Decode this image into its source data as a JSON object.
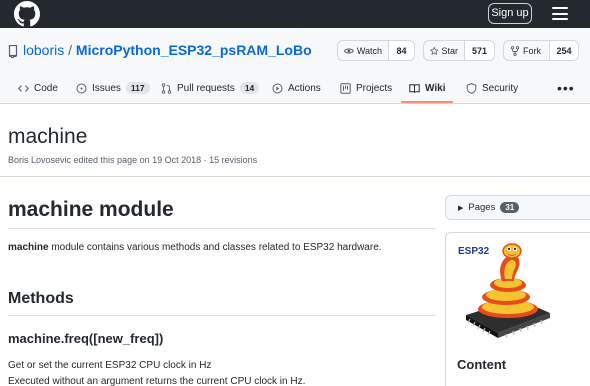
{
  "topbar": {
    "logo_icon": "github-mark-icon",
    "signup_label": "Sign up",
    "menu_icon": "hamburger-menu-icon"
  },
  "repo": {
    "icon": "repo-icon",
    "owner": "loboris",
    "separator": "/",
    "name": "MicroPython_ESP32_psRAM_LoBo",
    "watch": {
      "label": "Watch",
      "count": "84",
      "icon": "eye-icon"
    },
    "star": {
      "label": "Star",
      "count": "571",
      "icon": "star-icon"
    },
    "fork": {
      "label": "Fork",
      "count": "254",
      "icon": "fork-icon"
    }
  },
  "tabs": [
    {
      "label": "Code",
      "icon": "code-icon"
    },
    {
      "label": "Issues",
      "count": "117",
      "icon": "issue-icon"
    },
    {
      "label": "Pull requests",
      "count": "14",
      "icon": "pull-request-icon"
    },
    {
      "label": "Actions",
      "icon": "play-icon"
    },
    {
      "label": "Projects",
      "icon": "project-icon"
    },
    {
      "label": "Wiki",
      "icon": "book-icon",
      "active": true
    },
    {
      "label": "Security",
      "icon": "shield-icon"
    }
  ],
  "more_label": "•••",
  "wiki": {
    "title": "machine",
    "meta": "Boris Lovosevic edited this page on 19 Oct 2018 · 15 revisions"
  },
  "article": {
    "h1": "machine module",
    "intro_bold": "machine",
    "intro_rest": " module contains various methods and classes related to ESP32 hardware.",
    "h2": "Methods",
    "h3": "machine.freq([new_freq])",
    "p2": "Get or set the current ESP32 CPU clock in Hz",
    "p3": "Executed without an argument returns the current CPU clock in Hz."
  },
  "sidebar": {
    "pages_label": "Pages",
    "pages_count": "31",
    "logo_text": "ESP32",
    "content_title": "Content"
  },
  "colors": {
    "topbar_bg": "#24292f",
    "link": "#0969da",
    "active_tab_underline": "#fd8c73"
  }
}
